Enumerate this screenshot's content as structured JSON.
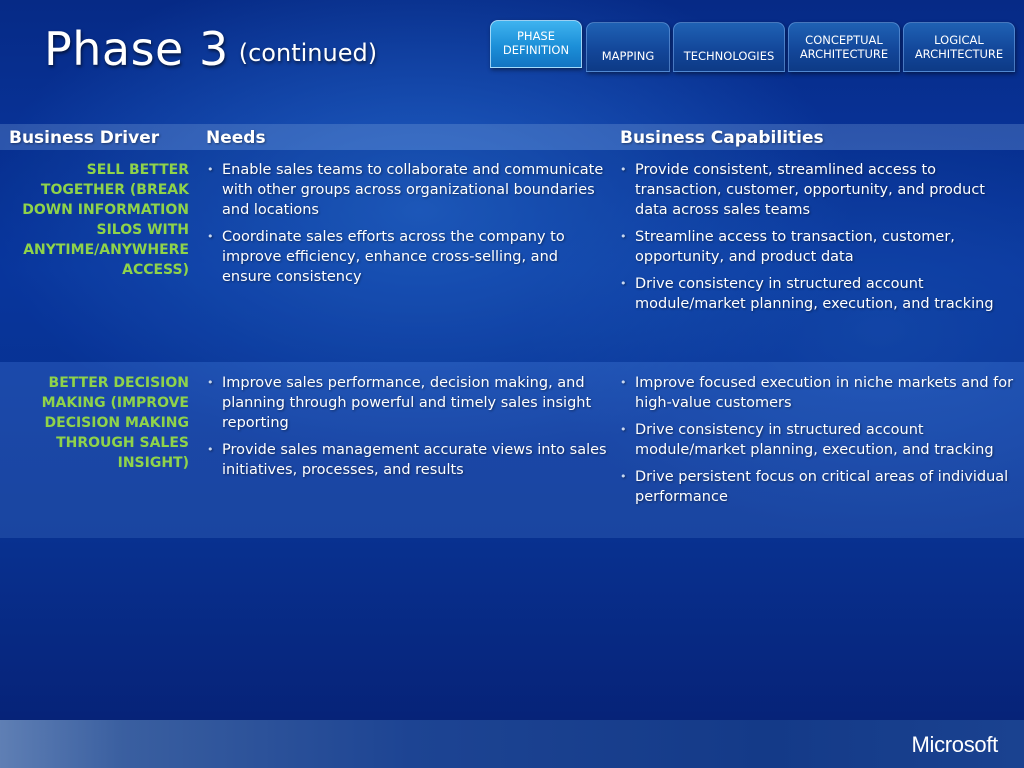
{
  "title": {
    "main": "Phase 3",
    "sub": "(continued)"
  },
  "tabs": [
    {
      "line1": "PHASE",
      "line2": "DEFINITION",
      "active": true
    },
    {
      "line1": "",
      "line2": "MAPPING",
      "active": false
    },
    {
      "line1": "",
      "line2": "TECHNOLOGIES",
      "active": false
    },
    {
      "line1": "CONCEPTUAL",
      "line2": "ARCHITECTURE",
      "active": false
    },
    {
      "line1": "LOGICAL",
      "line2": "ARCHITECTURE",
      "active": false
    }
  ],
  "table": {
    "headers": [
      "Business Driver",
      "Needs",
      "Business Capabilities"
    ],
    "rows": [
      {
        "driver": "Sell better together (break down information silos with anytime/anywhere access)",
        "needs": [
          "Enable sales teams to collaborate and communicate with other groups across organizational boundaries and locations",
          "Coordinate sales efforts across the company to improve efficiency, enhance cross-selling, and ensure consistency"
        ],
        "capabilities": [
          "Provide consistent, streamlined access to transaction, customer, opportunity, and product data across sales teams",
          "Streamline access to transaction, customer, opportunity, and product data",
          "Drive consistency in structured account module/market planning, execution, and tracking"
        ]
      },
      {
        "driver": "Better decision making (improve decision making through sales insight)",
        "needs": [
          "Improve sales performance, decision making, and planning through powerful and timely sales insight reporting",
          "Provide sales management accurate views into sales initiatives, processes, and results"
        ],
        "capabilities": [
          "Improve focused execution in niche markets and for high-value customers",
          "Drive consistency in structured account module/market planning, execution, and tracking",
          "Drive persistent focus on critical areas of individual performance"
        ]
      }
    ]
  },
  "bullet": "•",
  "footer": {
    "logo": "Microsoft"
  },
  "colors": {
    "driver": "#8fd34a",
    "active_tab": "#2aa3e6",
    "background": "#0a3aa6"
  }
}
